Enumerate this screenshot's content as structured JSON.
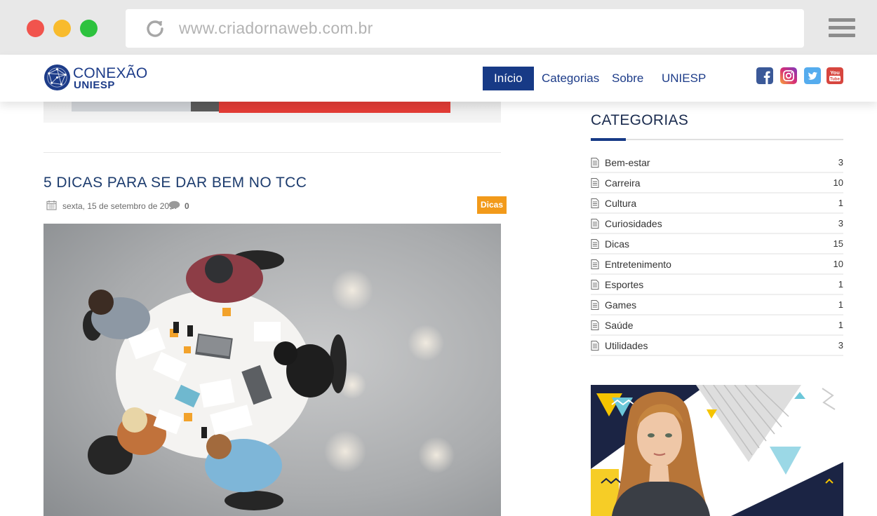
{
  "browser": {
    "url": "www.criadornaweb.com.br"
  },
  "site": {
    "logo_line1": "CONEXÃO",
    "logo_line2": "UNIESP",
    "nav": [
      {
        "label": "Início",
        "active": true
      },
      {
        "label": "Categorias",
        "active": false
      },
      {
        "label": "Sobre",
        "active": false
      },
      {
        "label": "UNIESP",
        "active": false
      }
    ],
    "social": [
      {
        "name": "facebook-icon",
        "color": "#3b5998"
      },
      {
        "name": "instagram-icon",
        "color": "#c13584"
      },
      {
        "name": "twitter-icon",
        "color": "#55acee"
      },
      {
        "name": "youtube-icon",
        "color": "#d7463f"
      }
    ]
  },
  "post": {
    "title": "5 DICAS PARA SE DAR BEM NO TCC",
    "date": "sexta, 15 de setembro de 2017",
    "comments": "0",
    "tag": "Dicas"
  },
  "sidebar": {
    "title": "CATEGORIAS",
    "categories": [
      {
        "label": "Bem-estar",
        "count": "3"
      },
      {
        "label": "Carreira",
        "count": "10"
      },
      {
        "label": "Cultura",
        "count": "1"
      },
      {
        "label": "Curiosidades",
        "count": "3"
      },
      {
        "label": "Dicas",
        "count": "15"
      },
      {
        "label": "Entretenimento",
        "count": "10"
      },
      {
        "label": "Esportes",
        "count": "1"
      },
      {
        "label": "Games",
        "count": "1"
      },
      {
        "label": "Saúde",
        "count": "1"
      },
      {
        "label": "Utilidades",
        "count": "3"
      }
    ]
  },
  "colors": {
    "brand": "#173a86",
    "tag": "#f29a1a"
  }
}
